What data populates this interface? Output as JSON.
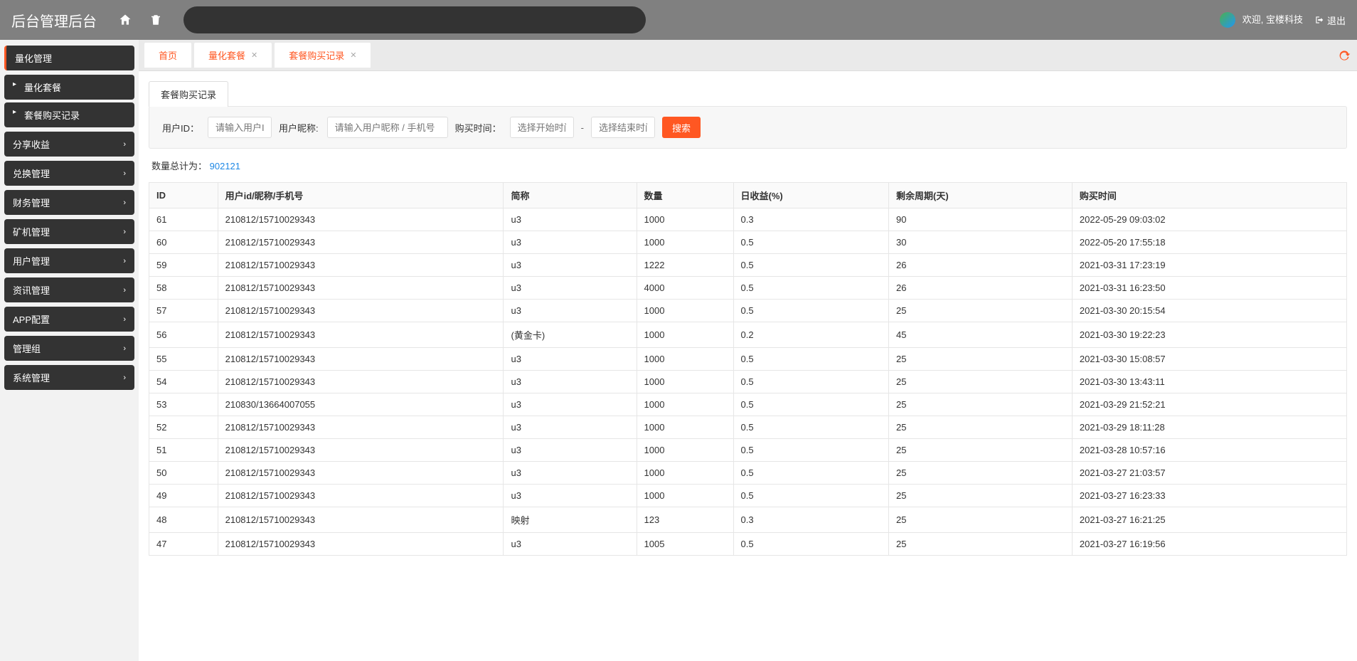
{
  "header": {
    "logo": "后台管理后台",
    "welcome": "欢迎, 宝楼科技",
    "logout": "退出"
  },
  "sidebar": {
    "items": [
      {
        "label": "量化管理",
        "expanded": true,
        "children": [
          {
            "label": "量化套餐"
          },
          {
            "label": "套餐购买记录"
          }
        ]
      },
      {
        "label": "分享收益"
      },
      {
        "label": "兑换管理"
      },
      {
        "label": "财务管理"
      },
      {
        "label": "矿机管理"
      },
      {
        "label": "用户管理"
      },
      {
        "label": "资讯管理"
      },
      {
        "label": "APP配置"
      },
      {
        "label": "管理组"
      },
      {
        "label": "系统管理"
      }
    ]
  },
  "tabs": [
    {
      "label": "首页",
      "closable": false
    },
    {
      "label": "量化套餐",
      "closable": true
    },
    {
      "label": "套餐购买记录",
      "closable": true,
      "active": true
    }
  ],
  "panel": {
    "title": "套餐购买记录",
    "filters": {
      "user_id_label": "用户ID：",
      "user_id_ph": "请输入用户ID",
      "nickname_label": "用户昵称:",
      "nickname_ph": "请输入用户昵称 / 手机号",
      "buy_time_label": "购买时间：",
      "start_ph": "选择开始时间",
      "end_ph": "选择结束时间",
      "search_btn": "搜索"
    },
    "total_label": "数量总计为：",
    "total_value": "902121",
    "columns": [
      "ID",
      "用户id/昵称/手机号",
      "简称",
      "数量",
      "日收益(%)",
      "剩余周期(天)",
      "购买时间"
    ],
    "rows": [
      {
        "id": "61",
        "user": "210812/15710029343",
        "name": "u3",
        "qty": "1000",
        "rate": "0.3",
        "days": "90",
        "time": "2022-05-29 09:03:02"
      },
      {
        "id": "60",
        "user": "210812/15710029343",
        "name": "u3",
        "qty": "1000",
        "rate": "0.5",
        "days": "30",
        "time": "2022-05-20 17:55:18"
      },
      {
        "id": "59",
        "user": "210812/15710029343",
        "name": "u3",
        "qty": "1222",
        "rate": "0.5",
        "days": "26",
        "time": "2021-03-31 17:23:19"
      },
      {
        "id": "58",
        "user": "210812/15710029343",
        "name": "u3",
        "qty": "4000",
        "rate": "0.5",
        "days": "26",
        "time": "2021-03-31 16:23:50"
      },
      {
        "id": "57",
        "user": "210812/15710029343",
        "name": "u3",
        "qty": "1000",
        "rate": "0.5",
        "days": "25",
        "time": "2021-03-30 20:15:54"
      },
      {
        "id": "56",
        "user": "210812/15710029343",
        "name": "(黄金卡)",
        "qty": "1000",
        "rate": "0.2",
        "days": "45",
        "time": "2021-03-30 19:22:23"
      },
      {
        "id": "55",
        "user": "210812/15710029343",
        "name": "u3",
        "qty": "1000",
        "rate": "0.5",
        "days": "25",
        "time": "2021-03-30 15:08:57"
      },
      {
        "id": "54",
        "user": "210812/15710029343",
        "name": "u3",
        "qty": "1000",
        "rate": "0.5",
        "days": "25",
        "time": "2021-03-30 13:43:11"
      },
      {
        "id": "53",
        "user": "210830/13664007055",
        "name": "u3",
        "qty": "1000",
        "rate": "0.5",
        "days": "25",
        "time": "2021-03-29 21:52:21"
      },
      {
        "id": "52",
        "user": "210812/15710029343",
        "name": "u3",
        "qty": "1000",
        "rate": "0.5",
        "days": "25",
        "time": "2021-03-29 18:11:28"
      },
      {
        "id": "51",
        "user": "210812/15710029343",
        "name": "u3",
        "qty": "1000",
        "rate": "0.5",
        "days": "25",
        "time": "2021-03-28 10:57:16"
      },
      {
        "id": "50",
        "user": "210812/15710029343",
        "name": "u3",
        "qty": "1000",
        "rate": "0.5",
        "days": "25",
        "time": "2021-03-27 21:03:57"
      },
      {
        "id": "49",
        "user": "210812/15710029343",
        "name": "u3",
        "qty": "1000",
        "rate": "0.5",
        "days": "25",
        "time": "2021-03-27 16:23:33"
      },
      {
        "id": "48",
        "user": "210812/15710029343",
        "name": "映射",
        "qty": "123",
        "rate": "0.3",
        "days": "25",
        "time": "2021-03-27 16:21:25"
      },
      {
        "id": "47",
        "user": "210812/15710029343",
        "name": "u3",
        "qty": "1005",
        "rate": "0.5",
        "days": "25",
        "time": "2021-03-27 16:19:56"
      }
    ]
  }
}
